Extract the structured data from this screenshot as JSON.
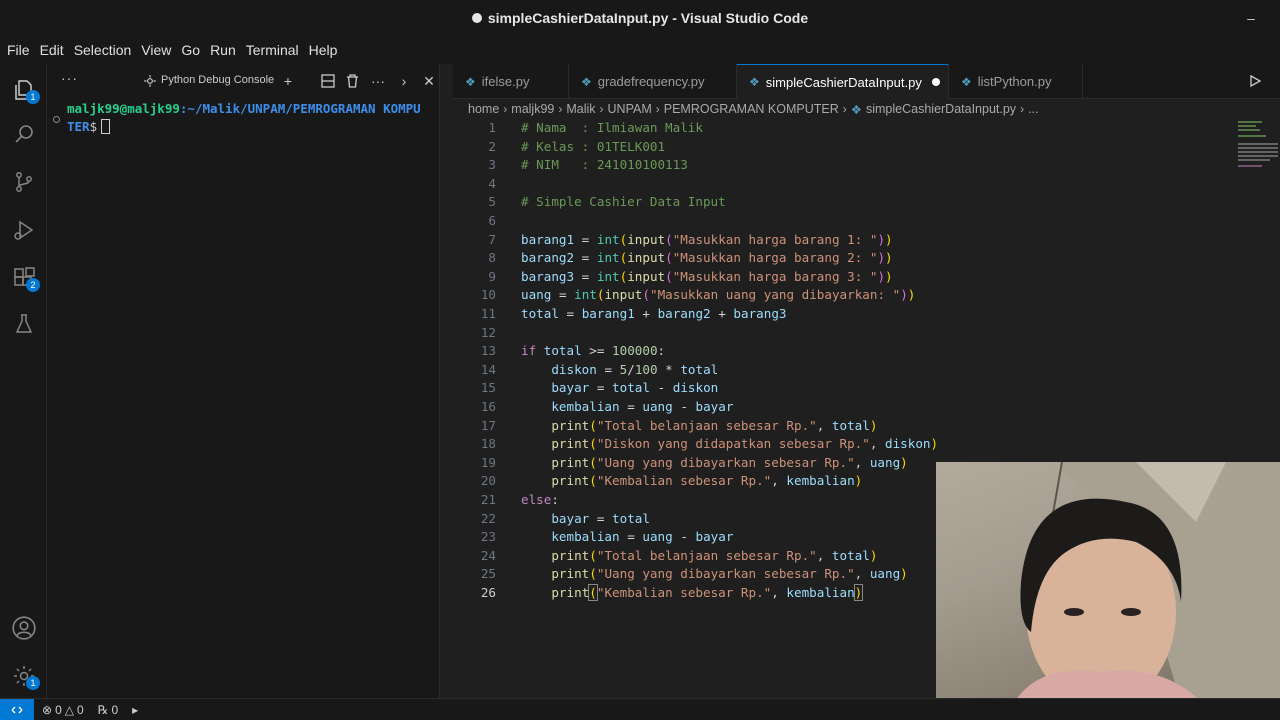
{
  "window": {
    "title": "simpleCashierDataInput.py - Visual Studio Code"
  },
  "menu": [
    "File",
    "Edit",
    "Selection",
    "View",
    "Go",
    "Run",
    "Terminal",
    "Help"
  ],
  "activity": {
    "explorer_badge": "1",
    "extensions_badge": "2"
  },
  "panel": {
    "more": "···",
    "console_label": "Python Debug Console",
    "terminal": {
      "user_host": "maljk99@maljk99",
      "path": ":~/Malik/UNPAM/PEMROGRAMAN KOMPU",
      "path_cont": "TER",
      "prompt_end": "$"
    }
  },
  "tabs": [
    {
      "label": "ifelse.py"
    },
    {
      "label": "gradefrequency.py"
    },
    {
      "label": "simpleCashierDataInput.py"
    },
    {
      "label": "listPython.py"
    }
  ],
  "breadcrumb": [
    "home",
    "maljk99",
    "Malik",
    "UNPAM",
    "PEMROGRAMAN KOMPUTER",
    "simpleCashierDataInput.py",
    "..."
  ],
  "editor": {
    "line_numbers": [
      "1",
      "2",
      "3",
      "4",
      "5",
      "6",
      "7",
      "8",
      "9",
      "10",
      "11",
      "12",
      "13",
      "14",
      "15",
      "16",
      "17",
      "18",
      "19",
      "20",
      "21",
      "22",
      "23",
      "24",
      "25",
      "26"
    ],
    "comments": {
      "nama": "# Nama  : Ilmiawan Malik",
      "kelas": "# Kelas : 01TELK001",
      "nim": "# NIM   : 241010100113",
      "heading": "# Simple Cashier Data Input"
    },
    "strings": {
      "s1": "\"Masukkan harga barang 1: \"",
      "s2": "\"Masukkan harga barang 2: \"",
      "s3": "\"Masukkan harga barang 3: \"",
      "s4": "\"Masukkan uang yang dibayarkan: \"",
      "total": "\"Total belanjaan sebesar Rp.\"",
      "diskon": "\"Diskon yang didapatkan sebesar Rp.\"",
      "uang": "\"Uang yang dibayarkan sebesar Rp.\"",
      "kembalian": "\"Kembalian sebesar Rp.\""
    },
    "numbers": {
      "threshold": "100000",
      "pct": "5",
      "hundred": "100"
    }
  },
  "status": {
    "errors": "0",
    "warnings": "0",
    "ports": "0"
  }
}
